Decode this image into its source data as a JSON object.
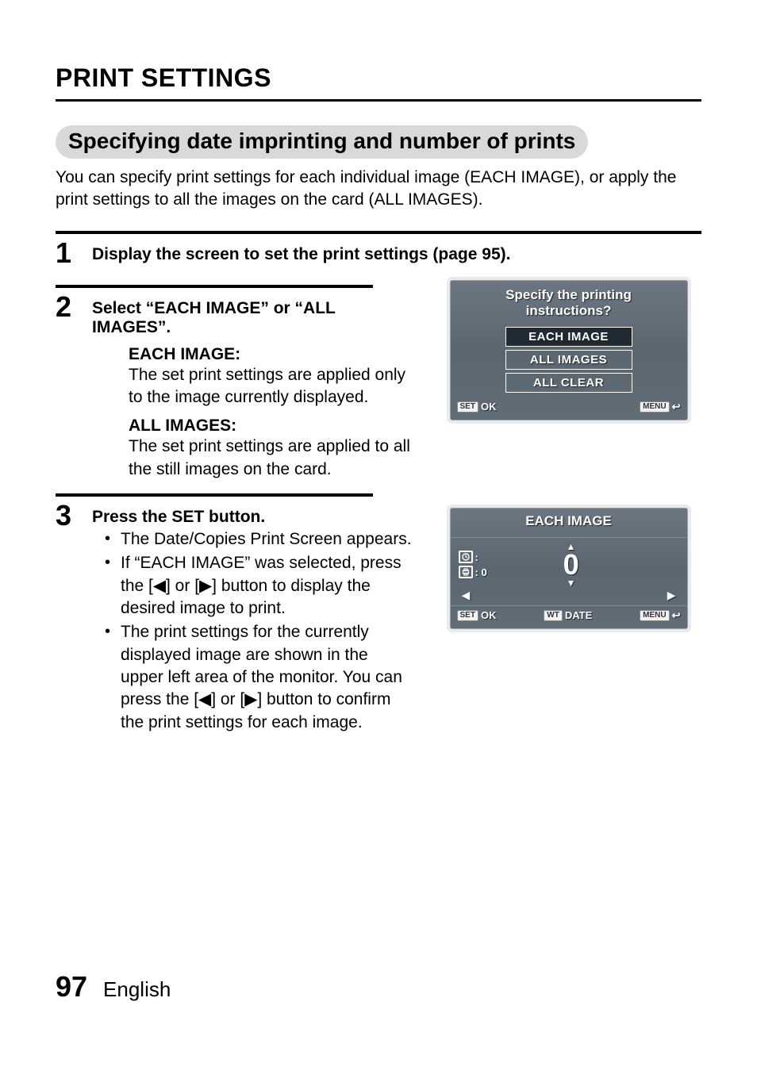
{
  "heading": "PRINT SETTINGS",
  "subheading": "Specifying date imprinting and number of prints",
  "intro": "You can specify print settings for each individual image (EACH IMAGE), or apply the print settings to all the images on the card (ALL IMAGES).",
  "steps": {
    "s1": {
      "num": "1",
      "title": "Display the screen to set the print settings (page 95)."
    },
    "s2": {
      "num": "2",
      "title": "Select “EACH IMAGE” or “ALL IMAGES”.",
      "defs": {
        "each_title": "EACH IMAGE:",
        "each_body": "The set print settings are applied only to the image currently displayed.",
        "all_title": "ALL IMAGES:",
        "all_body": "The set print settings are applied to all the still images on the card."
      }
    },
    "s3": {
      "num": "3",
      "title": "Press the SET button.",
      "bullets": [
        "The Date/Copies Print Screen appears.",
        "If “EACH IMAGE” was selected, press the [◀] or [▶] button to display the desired image to print.",
        "The print settings for the currently displayed image are shown in the upper left area of the monitor. You can press the [◀] or [▶] button to confirm the print settings for each image."
      ]
    }
  },
  "lcd1": {
    "title_l1": "Specify the printing",
    "title_l2": "instructions?",
    "options": [
      "EACH IMAGE",
      "ALL IMAGES",
      "ALL CLEAR"
    ],
    "bottom": {
      "set": "SET",
      "ok": "OK",
      "menu": "MENU",
      "return_icon": "↩"
    }
  },
  "lcd2": {
    "title": "EACH IMAGE",
    "clock_value": ":",
    "print_value": ": 0",
    "counter": "0",
    "bottom": {
      "set": "SET",
      "ok": "OK",
      "wt": "WT",
      "date": "DATE",
      "menu": "MENU",
      "return_icon": "↩"
    }
  },
  "footer": {
    "page": "97",
    "lang": "English"
  }
}
